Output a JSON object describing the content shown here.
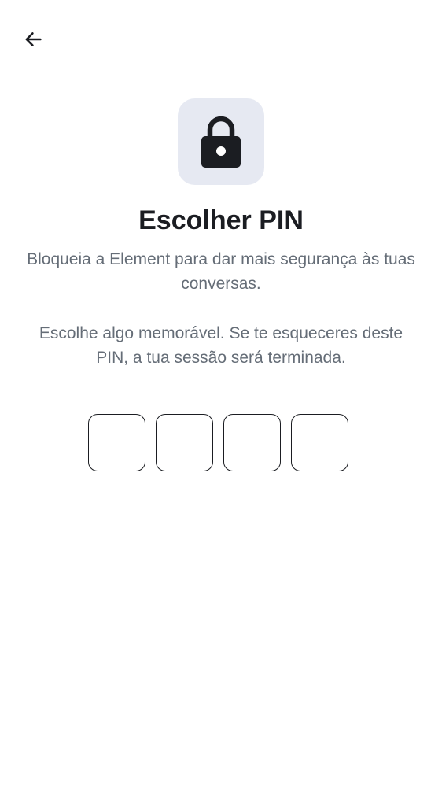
{
  "header": {
    "back_icon": "arrow-left-icon"
  },
  "lock": {
    "icon": "lock-icon",
    "tile_color": "#e6e9f2"
  },
  "title": "Escolher PIN",
  "description_1": "Bloqueia a Element para dar mais segurança às tuas conversas.",
  "description_2": "Escolhe algo memorável. Se te esqueceres deste PIN, a tua sessão será terminada.",
  "pin": {
    "length": 4,
    "digits": [
      "",
      "",
      "",
      ""
    ]
  },
  "colors": {
    "text_primary": "#1b1d22",
    "text_secondary": "#656d77",
    "background": "#ffffff"
  }
}
